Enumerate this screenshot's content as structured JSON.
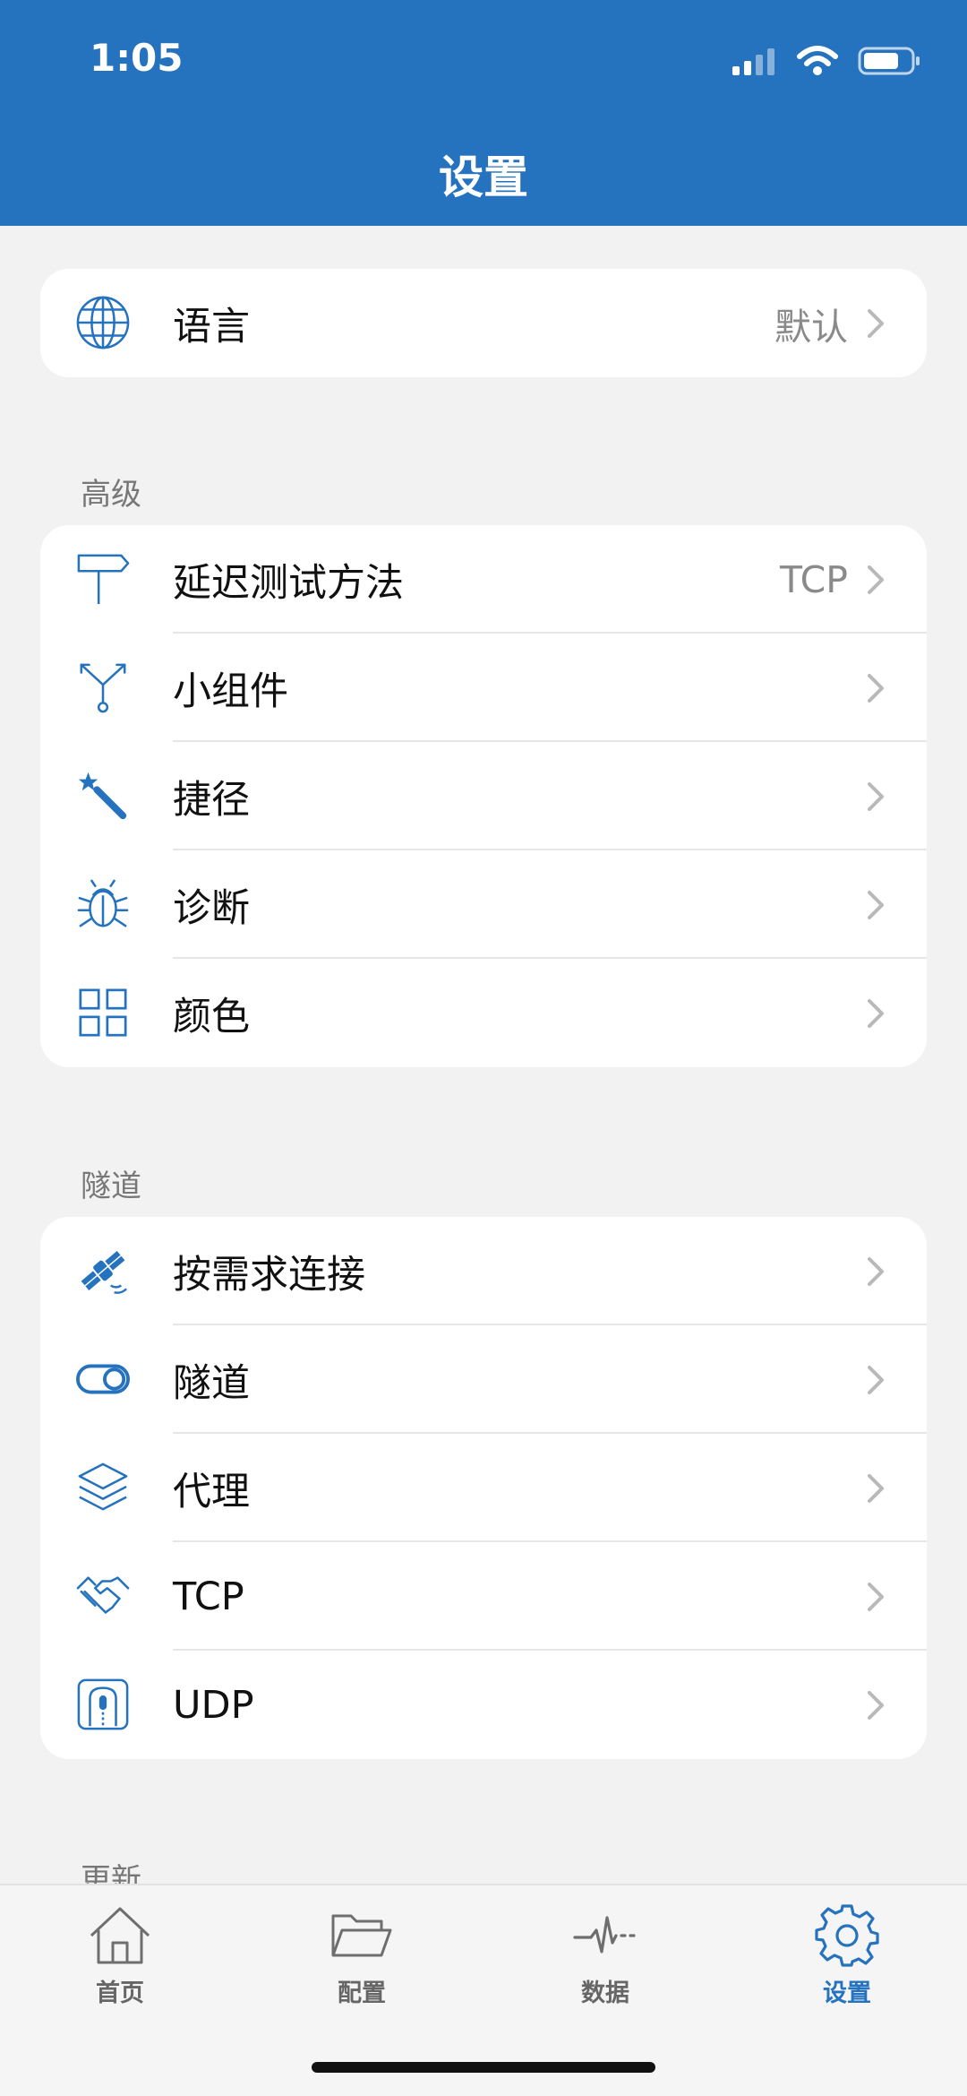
{
  "status": {
    "time": "1:05"
  },
  "header": {
    "title": "设置"
  },
  "language": {
    "label": "语言",
    "value": "默认"
  },
  "sections": {
    "advanced": {
      "title": "高级",
      "items": [
        {
          "label": "延迟测试方法",
          "value": "TCP",
          "icon": "signpost-icon"
        },
        {
          "label": "小组件",
          "value": "",
          "icon": "branch-icon"
        },
        {
          "label": "捷径",
          "value": "",
          "icon": "magic-wand-icon"
        },
        {
          "label": "诊断",
          "value": "",
          "icon": "bug-icon"
        },
        {
          "label": "颜色",
          "value": "",
          "icon": "grid-icon"
        }
      ]
    },
    "tunnel": {
      "title": "隧道",
      "items": [
        {
          "label": "按需求连接",
          "icon": "satellite-icon"
        },
        {
          "label": "隧道",
          "icon": "toggle-icon"
        },
        {
          "label": "代理",
          "icon": "layers-icon"
        },
        {
          "label": "TCP",
          "icon": "handshake-icon"
        },
        {
          "label": "UDP",
          "icon": "tunnel-icon"
        }
      ]
    },
    "update": {
      "title": "更新"
    }
  },
  "tabs": [
    {
      "label": "首页",
      "icon": "home-icon",
      "active": false
    },
    {
      "label": "配置",
      "icon": "folder-icon",
      "active": false
    },
    {
      "label": "数据",
      "icon": "pulse-icon",
      "active": false
    },
    {
      "label": "设置",
      "icon": "gear-icon",
      "active": true
    }
  ],
  "colors": {
    "accent": "#2572be",
    "background": "#f2f2f2"
  }
}
